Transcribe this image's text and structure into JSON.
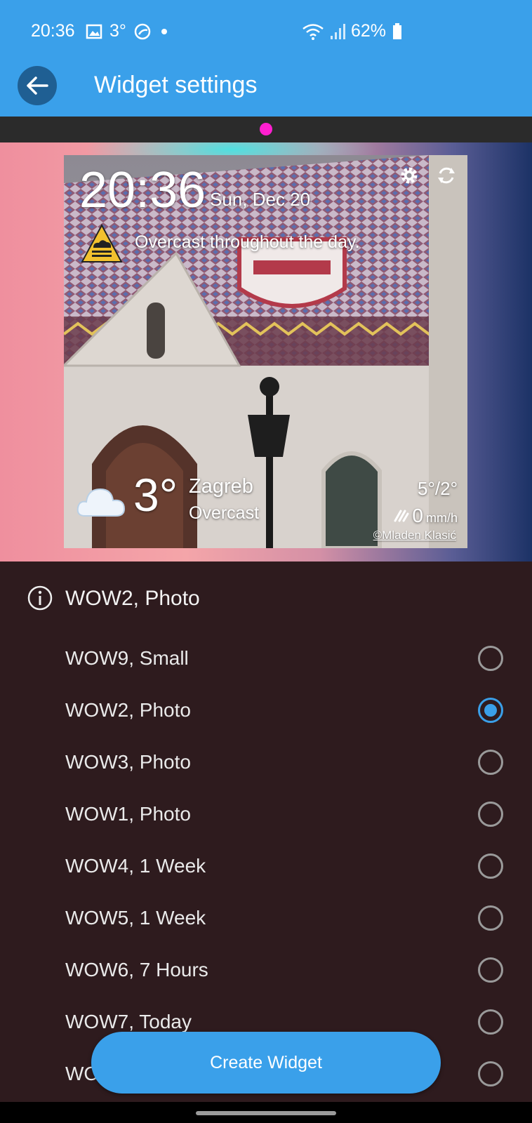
{
  "status_bar": {
    "time": "20:36",
    "temp": "3°",
    "battery": "62%",
    "icons": [
      "gallery-icon",
      "weather-moon-icon",
      "dot-icon",
      "wifi-icon",
      "signal-icon",
      "battery-icon"
    ]
  },
  "app_bar": {
    "title": "Widget settings",
    "back_icon": "arrow-left-icon"
  },
  "pager": {
    "active_color": "#ff1fd0"
  },
  "widget_preview": {
    "time": "20:36",
    "date": "Sun, Dec 20",
    "summary": "Overcast throughout the day.",
    "temperature": "3°",
    "city": "Zagreb",
    "condition": "Overcast",
    "hi_lo": "5°/2°",
    "precip_value": "0",
    "precip_unit": "mm/h",
    "credit": "©Mladen Klasić"
  },
  "list": {
    "header_label": "WOW2, Photo",
    "options": [
      {
        "label": "WOW9, Small",
        "selected": false
      },
      {
        "label": "WOW2, Photo",
        "selected": true
      },
      {
        "label": "WOW3, Photo",
        "selected": false
      },
      {
        "label": "WOW1, Photo",
        "selected": false
      },
      {
        "label": "WOW4, 1 Week",
        "selected": false
      },
      {
        "label": "WOW5, 1 Week",
        "selected": false
      },
      {
        "label": "WOW6, 7 Hours",
        "selected": false
      },
      {
        "label": "WOW7, Today",
        "selected": false
      },
      {
        "label": "WO",
        "selected": false
      }
    ]
  },
  "create_button": {
    "label": "Create Widget"
  },
  "colors": {
    "accent": "#3aa0ea",
    "background": "#2e1b1e",
    "status_bar": "#3aa0ea"
  }
}
